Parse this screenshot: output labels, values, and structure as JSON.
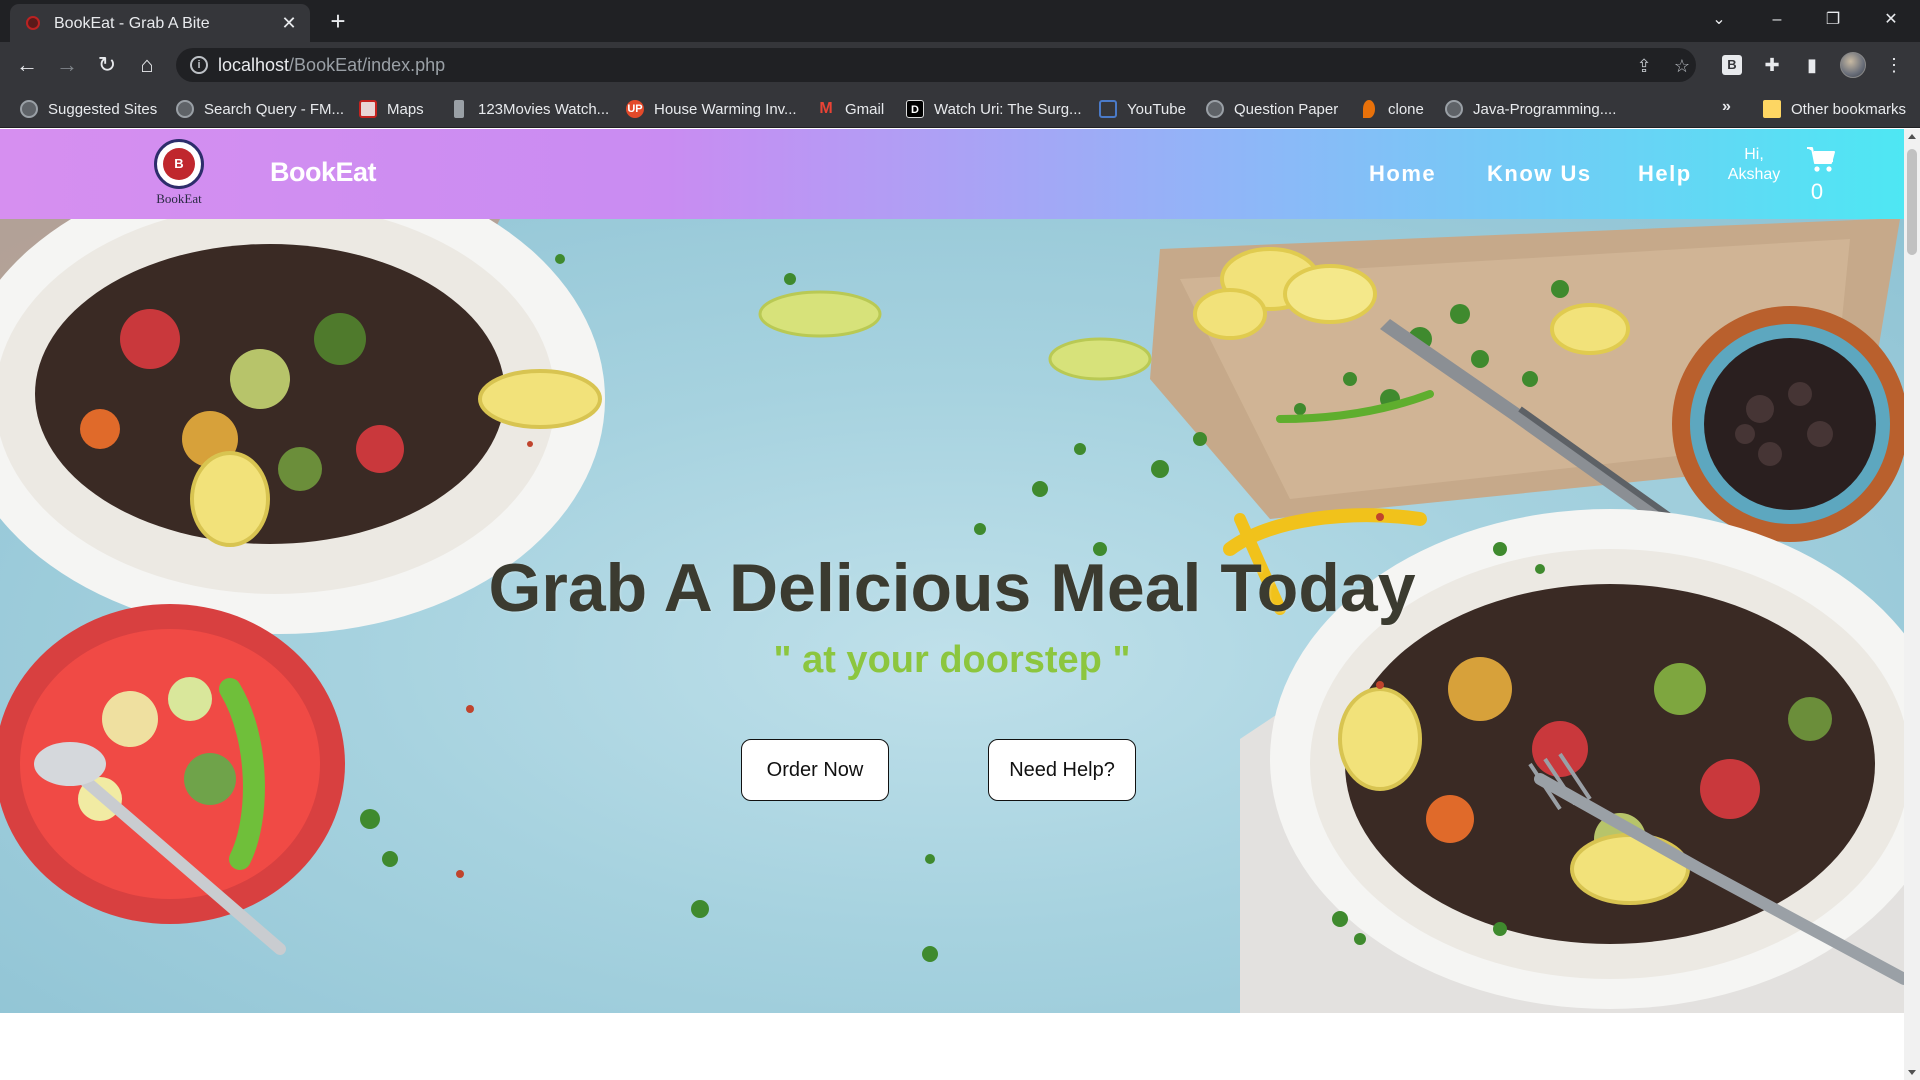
{
  "browser": {
    "tab_title": "BookEat - Grab A Bite",
    "url_host": "localhost",
    "url_path": "/BookEat/index.php",
    "bookmarks": [
      {
        "label": "Suggested Sites",
        "icon": "globe-icon"
      },
      {
        "label": "Search Query - FM...",
        "icon": "globe-icon"
      },
      {
        "label": "Maps",
        "icon": "maps-icon"
      },
      {
        "label": "123Movies Watch...",
        "icon": "movie-icon"
      },
      {
        "label": "House Warming Inv...",
        "icon": "up-icon"
      },
      {
        "label": "Gmail",
        "icon": "gmail-icon"
      },
      {
        "label": "Watch Uri: The Surg...",
        "icon": "d-icon"
      },
      {
        "label": "YouTube",
        "icon": "youtube-icon"
      },
      {
        "label": "Question Paper",
        "icon": "globe-icon"
      },
      {
        "label": "clone",
        "icon": "clone-icon"
      },
      {
        "label": "Java-Programming....",
        "icon": "globe-icon"
      }
    ],
    "more_bookmarks": "»",
    "other_bookmarks": "Other bookmarks",
    "extension_badge": "B"
  },
  "site": {
    "logo_text": "BookEat",
    "logo_mark": "B",
    "brand": "BookEat",
    "nav": [
      "Home",
      "Know Us",
      "Help"
    ],
    "greeting_line1": "Hi,",
    "greeting_line2": "Akshay",
    "cart_count": "0"
  },
  "hero": {
    "title": "Grab A Delicious Meal Today",
    "subtitle": "\" at your doorstep \"",
    "order_button": "Order Now",
    "help_button": "Need Help?"
  },
  "colors": {
    "nav_gradient_start": "#d68ff0",
    "nav_gradient_end": "#4ee7f3",
    "subtitle_green": "#8cc63f",
    "hero_background": "#a6d2df"
  }
}
